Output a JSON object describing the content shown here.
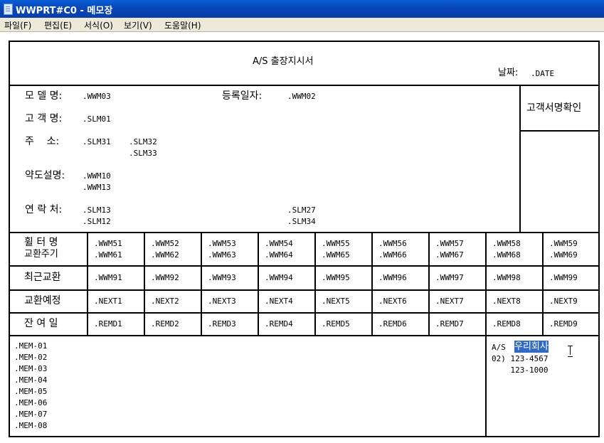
{
  "window": {
    "title": "WWPRT#C0 - 메모장"
  },
  "menu": [
    "파일(F)",
    "편집(E)",
    "서식(O)",
    "보기(V)",
    "도움말(H)"
  ],
  "form": {
    "title": "A/S 출장지시서",
    "date_label": "날짜:",
    "date_value": ".DATE",
    "model_label": "모 델 명:",
    "model_value": ".WWM03",
    "regdate_label": "등록일자:",
    "regdate_value": ".WWM02",
    "customer_label": "고 객 명:",
    "customer_value": ".SLM01",
    "address_label": "주    소:",
    "address_values": [
      ".SLM31",
      ".SLM32",
      ".SLM33"
    ],
    "map_label": "약도설명:",
    "map_values": [
      ".WWM10",
      ".WWM13"
    ],
    "contact_label": "연 락 처:",
    "contact_values": [
      ".SLM13",
      ".SLM12",
      ".SLM27",
      ".SLM34"
    ],
    "signature_label": "고객서명확인",
    "filter_label_1": "휠 터 명",
    "filter_label_2": "교환주기",
    "filter_names": [
      ".WWM51",
      ".WWM52",
      ".WWM53",
      ".WWM54",
      ".WWM55",
      ".WWM56",
      ".WWM57",
      ".WWM58",
      ".WWM59"
    ],
    "filter_cycles": [
      ".WWM61",
      ".WWM62",
      ".WWM63",
      ".WWM64",
      ".WWM65",
      ".WWM66",
      ".WWM67",
      ".WWM68",
      ".WWM69"
    ],
    "recent_label": "최근교환",
    "recent_values": [
      ".WWM91",
      ".WWM92",
      ".WWM93",
      ".WWM94",
      ".WWM95",
      ".WWM96",
      ".WWM97",
      ".WWM98",
      ".WWM99"
    ],
    "next_label": "교환예정",
    "next_values": [
      ".NEXT1",
      ".NEXT2",
      ".NEXT3",
      ".NEXT4",
      ".NEXT5",
      ".NEXT6",
      ".NEXT7",
      ".NEXT8",
      ".NEXT9"
    ],
    "remain_label": "잔 여 일",
    "remain_values": [
      ".REMD1",
      ".REMD2",
      ".REMD3",
      ".REMD4",
      ".REMD5",
      ".REMD6",
      ".REMD7",
      ".REMD8",
      ".REMD9"
    ],
    "memos": [
      ".MEM-01",
      ".MEM-02",
      ".MEM-03",
      ".MEM-04",
      ".MEM-05",
      ".MEM-06",
      ".MEM-07",
      ".MEM-08"
    ],
    "company_prefix": "A/S",
    "company_name": "우리회사",
    "phone_1": "02) 123-4567",
    "phone_2": "    123-1000"
  }
}
